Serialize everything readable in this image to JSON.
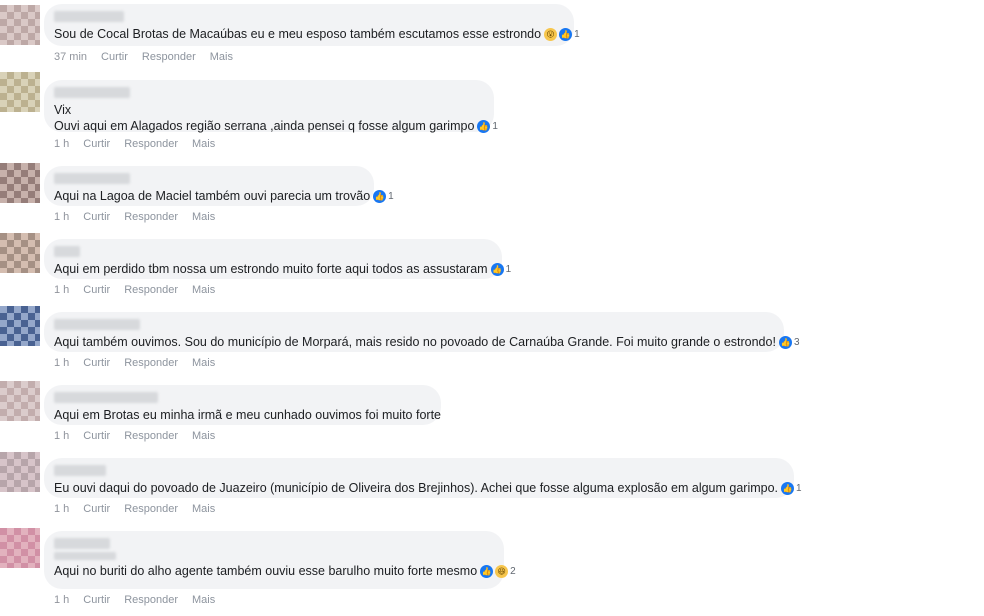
{
  "comments": [
    {
      "lines": [
        "Sou de Cocal Brotas de Macaúbas eu e meu esposo também escutamos esse estrondo"
      ],
      "reaction_icons": [
        "surprised-emoji-icon",
        "like-icon"
      ],
      "reaction_count": "1",
      "time": "37 min",
      "actions": [
        "Curtir",
        "Responder",
        "Mais"
      ]
    },
    {
      "lines": [
        "Vix",
        "Ouvi aqui em Alagados região serrana ,ainda pensei q fosse algum garimpo"
      ],
      "reaction_icons": [
        "like-icon"
      ],
      "reaction_count": "1",
      "time": "1 h",
      "actions": [
        "Curtir",
        "Responder",
        "Mais"
      ]
    },
    {
      "lines": [
        "Aqui na Lagoa de Maciel também ouvi parecia um trovão"
      ],
      "reaction_icons": [
        "like-icon"
      ],
      "reaction_count": "1",
      "time": "1 h",
      "actions": [
        "Curtir",
        "Responder",
        "Mais"
      ]
    },
    {
      "lines": [
        "Aqui em perdido tbm nossa um estrondo muito forte aqui todos as assustaram"
      ],
      "reaction_icons": [
        "like-icon"
      ],
      "reaction_count": "1",
      "time": "1 h",
      "actions": [
        "Curtir",
        "Responder",
        "Mais"
      ]
    },
    {
      "lines": [
        "Aqui também ouvimos. Sou do município de Morpará, mais resido no povoado de Carnaúba Grande. Foi muito grande o estrondo!"
      ],
      "reaction_icons": [
        "like-icon"
      ],
      "reaction_count": "3",
      "time": "1 h",
      "actions": [
        "Curtir",
        "Responder",
        "Mais"
      ]
    },
    {
      "lines": [
        "Aqui em Brotas eu minha irmã e meu cunhado ouvimos foi muito forte"
      ],
      "reaction_icons": [],
      "reaction_count": "",
      "time": "1 h",
      "actions": [
        "Curtir",
        "Responder",
        "Mais"
      ]
    },
    {
      "lines": [
        "Eu ouvi daqui do povoado de Juazeiro (município de Oliveira dos Brejinhos). Achei que fosse alguma explosão em algum garimpo."
      ],
      "reaction_icons": [
        "like-icon"
      ],
      "reaction_count": "1",
      "time": "1 h",
      "actions": [
        "Curtir",
        "Responder",
        "Mais"
      ]
    },
    {
      "lines": [
        "Aqui no buriti do alho agente também ouviu esse barulho muito forte mesmo"
      ],
      "reaction_icons": [
        "like-icon",
        "laughing-emoji-icon"
      ],
      "reaction_count": "2",
      "time": "1 h",
      "actions": [
        "Curtir",
        "Responder",
        "Mais"
      ]
    }
  ],
  "colors": {
    "bubble_bg": "#f2f3f5",
    "like_blue": "#1877f2",
    "meta_text": "#90949c"
  }
}
